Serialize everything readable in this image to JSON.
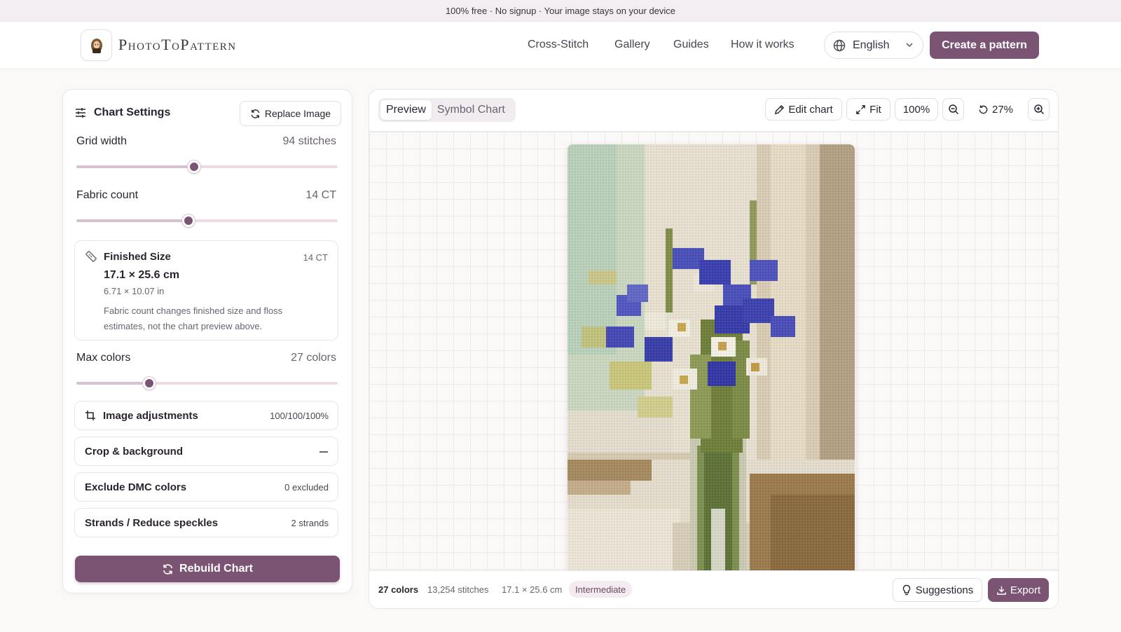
{
  "banner": {
    "text": "100% free · No signup · Your image stays on your device"
  },
  "brand": {
    "name": "PhotoToPattern"
  },
  "nav": {
    "links": [
      "Cross-Stitch",
      "Gallery",
      "Guides",
      "How it works"
    ],
    "language": "English",
    "cta": "Create a pattern"
  },
  "settings": {
    "title": "Chart Settings",
    "replace_label": "Replace Image",
    "grid_width": {
      "label": "Grid width",
      "value": "94 stitches",
      "fraction": 0.45
    },
    "fabric_count": {
      "label": "Fabric count",
      "value": "14 CT",
      "fraction": 0.43
    },
    "finished": {
      "title": "Finished Size",
      "ct": "14 CT",
      "cm": "17.1 × 25.6 cm",
      "inches": "6.71 × 10.07 in",
      "note": "Fabric count changes finished size and floss estimates, not the chart preview above."
    },
    "max_colors": {
      "label": "Max colors",
      "value": "27 colors",
      "fraction": 0.28
    },
    "image_adjustments": {
      "label": "Image adjustments",
      "value": "100/100/100%"
    },
    "crop": {
      "label": "Crop & background"
    },
    "exclude": {
      "label": "Exclude DMC colors",
      "value": "0 excluded"
    },
    "strands": {
      "label": "Strands / Reduce speckles",
      "value": "2 strands"
    },
    "rebuild_label": "Rebuild Chart"
  },
  "preview": {
    "tabs": [
      "Preview",
      "Symbol Chart"
    ],
    "active_tab": "Preview",
    "edit_label": "Edit chart",
    "fit_label": "Fit",
    "zoom_100": "100%",
    "zoom_level": "27%",
    "status": {
      "colors": "27 colors",
      "stitches": "13,254 stitches",
      "size": "17.1 × 25.6 cm",
      "difficulty": "Intermediate"
    },
    "suggestions_label": "Suggestions",
    "export_label": "Export"
  },
  "colors": {
    "accent": "#7b5474",
    "cornflower": "#3b3fb0",
    "stem_green": "#6f7f3a",
    "background_cream": "#e9e2d3"
  }
}
